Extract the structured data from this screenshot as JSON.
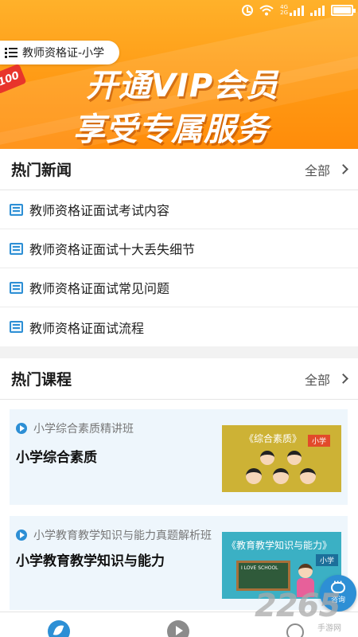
{
  "status_bar": {
    "network_top": "4G",
    "network_bottom": "2G"
  },
  "banner": {
    "region": "教师资格证-小学",
    "promo_line1": "开通VIP会员",
    "promo_line2": "享受专属服务",
    "badge": "100"
  },
  "news": {
    "title": "热门新闻",
    "all_label": "全部",
    "items": [
      "教师资格证面试考试内容",
      "教师资格证面试十大丢失细节",
      "教师资格证面试常见问题",
      "教师资格证面试流程"
    ]
  },
  "courses": {
    "title": "热门课程",
    "all_label": "全部",
    "items": [
      {
        "subtitle": "小学综合素质精讲班",
        "title": "小学综合素质",
        "thumb_caption": "《综合素质》",
        "thumb_tag": "小学"
      },
      {
        "subtitle": "小学教育教学知识与能力真题解析班",
        "title": "小学教育教学知识与能力",
        "thumb_caption": "《教育教学知识与能力》",
        "thumb_tag": "小学",
        "board_text": "I LOVE SCHOOL"
      }
    ]
  },
  "consult": {
    "label": "咨询"
  },
  "watermark": {
    "logo": "2265",
    "sub": "手游网"
  }
}
